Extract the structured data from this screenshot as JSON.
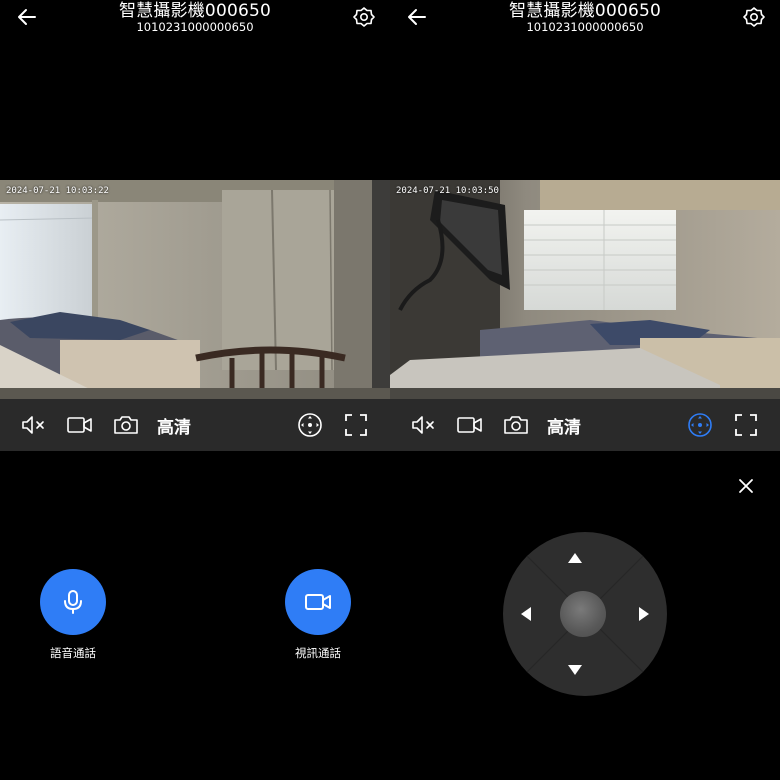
{
  "left": {
    "header": {
      "title": "智慧攝影機000650",
      "serial": "1010231000000650"
    },
    "video": {
      "timestamp": "2024-07-21 10:03:22"
    },
    "controls": {
      "quality_label": "高清"
    },
    "calls": {
      "voice_label": "語音通話",
      "video_label": "視訊通話"
    }
  },
  "right": {
    "header": {
      "title": "智慧攝影機000650",
      "serial": "1010231000000650"
    },
    "video": {
      "timestamp": "2024-07-21 10:03:50"
    },
    "controls": {
      "quality_label": "高清"
    }
  },
  "colors": {
    "background": "#000000",
    "control_bar": "#2a2a2a",
    "accent": "#2f7df6",
    "joystick": "#2e2e2e"
  },
  "icons": [
    "back-arrow-icon",
    "settings-flower-icon",
    "mute-icon",
    "record-video-icon",
    "snapshot-camera-icon",
    "ptz-icon",
    "fullscreen-icon",
    "microphone-icon",
    "video-camera-icon",
    "close-icon",
    "arrow-up-icon",
    "arrow-down-icon",
    "arrow-left-icon",
    "arrow-right-icon"
  ]
}
